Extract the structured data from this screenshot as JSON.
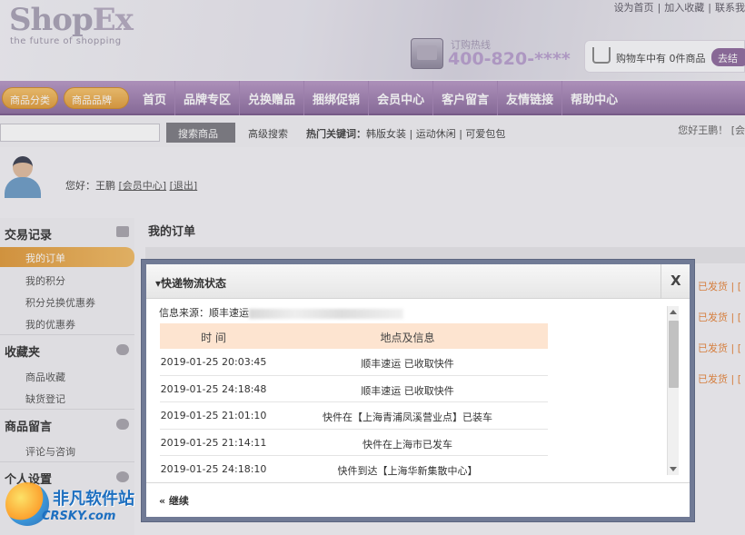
{
  "header": {
    "logo_main": "Shop",
    "logo_ex": "Ex",
    "slogan": "the future of shopping",
    "top_links": [
      "设为首页",
      "|",
      "加入收藏",
      "|",
      "联系我"
    ],
    "hotline_label": "订购热线",
    "hotline_number": "400-820-****",
    "cart_text": "购物车中有 0件商品",
    "checkout_label": "去结"
  },
  "nav": {
    "category_button": "商品分类",
    "brand_button": "商品品牌",
    "items": [
      "首页",
      "品牌专区",
      "兑换赠品",
      "捆绑促销",
      "会员中心",
      "客户留言",
      "友情链接",
      "帮助中心"
    ]
  },
  "search": {
    "button_label": "搜索商品",
    "advanced": "高级搜索",
    "hot_label": "热门关键词：",
    "hot_keywords": "韩版女装 | 运动休闲 | 可爱包包",
    "right_greeting": "您好王鹏！ [会"
  },
  "user": {
    "greeting": "您好：王鹏",
    "member_link": "[会员中心]",
    "logout_link": "[退出]"
  },
  "sidebar": {
    "sections": [
      {
        "title": "交易记录",
        "items": [
          "我的订单",
          "我的积分",
          "积分兑换优惠券",
          "我的优惠券"
        ]
      },
      {
        "title": "收藏夹",
        "items": [
          "商品收藏",
          "缺货登记"
        ]
      },
      {
        "title": "商品留言",
        "items": [
          "评论与咨询"
        ]
      },
      {
        "title": "个人设置",
        "items": []
      }
    ]
  },
  "main": {
    "title": "我的订单",
    "status_texts": [
      "已发货 | [",
      "已发货 | [",
      "已发货 | [",
      "已发货 | ["
    ]
  },
  "modal": {
    "title": "▾快递物流状态",
    "close": "X",
    "source_label": "信息来源：顺丰速运",
    "columns": [
      "时 间",
      "地点及信息"
    ],
    "rows": [
      {
        "time": "2019-01-25 20:03:45",
        "info": "顺丰速运 已收取快件"
      },
      {
        "time": "2019-01-25 24:18:48",
        "info": "顺丰速运 已收取快件"
      },
      {
        "time": "2019-01-25 21:01:10",
        "info": "快件在【上海青浦凤溪营业点】已装车"
      },
      {
        "time": "2019-01-25 21:14:11",
        "info": "快件在上海市已发车"
      },
      {
        "time": "2019-01-25 24:18:10",
        "info": "快件到达【上海华新集散中心】"
      }
    ],
    "continue": "« 继续"
  },
  "watermark": {
    "name": "非凡软件站",
    "site": "CRSKY.com"
  },
  "colors": {
    "nav_purple": "#8d6d9f",
    "accent_orange": "#e19a3a",
    "table_head": "#fde4d0",
    "modal_frame": "#707a95"
  }
}
